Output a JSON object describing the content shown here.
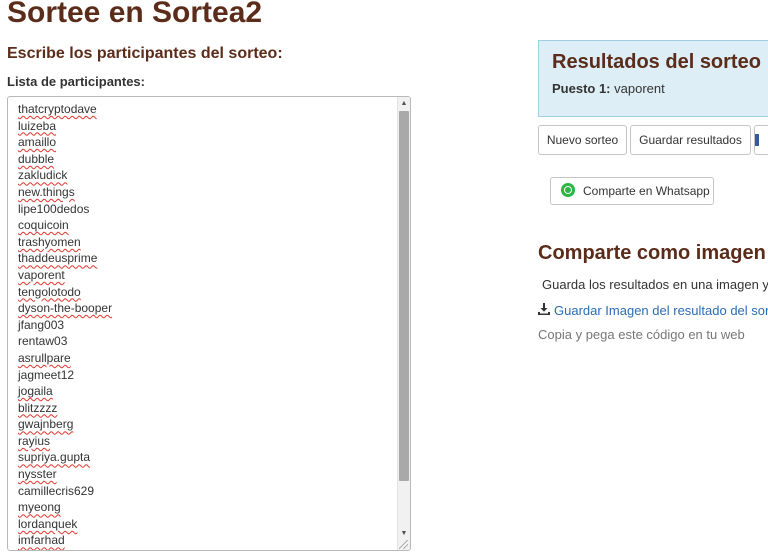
{
  "page": {
    "title": "Sortee en Sortea2",
    "subtitle": "Escribe los participantes del sorteo:",
    "list_label": "Lista de participantes:"
  },
  "participants": [
    {
      "name": "thatcryptodave",
      "misspelled": true
    },
    {
      "name": "luizeba",
      "misspelled": true
    },
    {
      "name": "amaillo",
      "misspelled": true
    },
    {
      "name": "dubble",
      "misspelled": true
    },
    {
      "name": "zakludick",
      "misspelled": true
    },
    {
      "name": "new.things",
      "misspelled": true
    },
    {
      "name": "lipe100dedos",
      "misspelled": false
    },
    {
      "name": "coquicoin",
      "misspelled": true
    },
    {
      "name": "trashyomen",
      "misspelled": true
    },
    {
      "name": "thaddeusprime",
      "misspelled": true
    },
    {
      "name": "vaporent",
      "misspelled": true
    },
    {
      "name": "tengolotodo",
      "misspelled": true
    },
    {
      "name": "dyson-the-booper",
      "misspelled": true
    },
    {
      "name": "jfang003",
      "misspelled": false
    },
    {
      "name": "rentaw03",
      "misspelled": false
    },
    {
      "name": "asrullpare",
      "misspelled": true
    },
    {
      "name": "jagmeet12",
      "misspelled": false
    },
    {
      "name": "jogaila",
      "misspelled": true
    },
    {
      "name": "blitzzzz",
      "misspelled": true
    },
    {
      "name": "gwajnberg",
      "misspelled": true
    },
    {
      "name": "rayius",
      "misspelled": true
    },
    {
      "name": "supriya.gupta",
      "misspelled": true
    },
    {
      "name": "nysster",
      "misspelled": true
    },
    {
      "name": "camillecris629",
      "misspelled": false
    },
    {
      "name": "myeong",
      "misspelled": true
    },
    {
      "name": "lordanquek",
      "misspelled": true
    },
    {
      "name": "imfarhad",
      "misspelled": true
    }
  ],
  "results": {
    "title": "Resultados del sorteo",
    "position_label": "Puesto 1:",
    "winner": "vaporent"
  },
  "actions": {
    "new_draw": "Nuevo sorteo",
    "save_results": "Guardar resultados",
    "whatsapp_share": "Comparte en Whatsapp"
  },
  "share": {
    "title": "Comparte como imagen",
    "description": "Guarda los resultados en una imagen y",
    "download_link": "Guardar Imagen del resultado del sor",
    "embed_text": "Copia y pega este código en tu web"
  },
  "icons": {
    "download": "download-icon",
    "whatsapp": "whatsapp-icon",
    "facebook": "facebook-icon"
  },
  "colors": {
    "heading": "#5b2c1a",
    "results_bg": "#ddeef6",
    "link": "#2a6db5",
    "whatsapp": "#2cb742"
  }
}
